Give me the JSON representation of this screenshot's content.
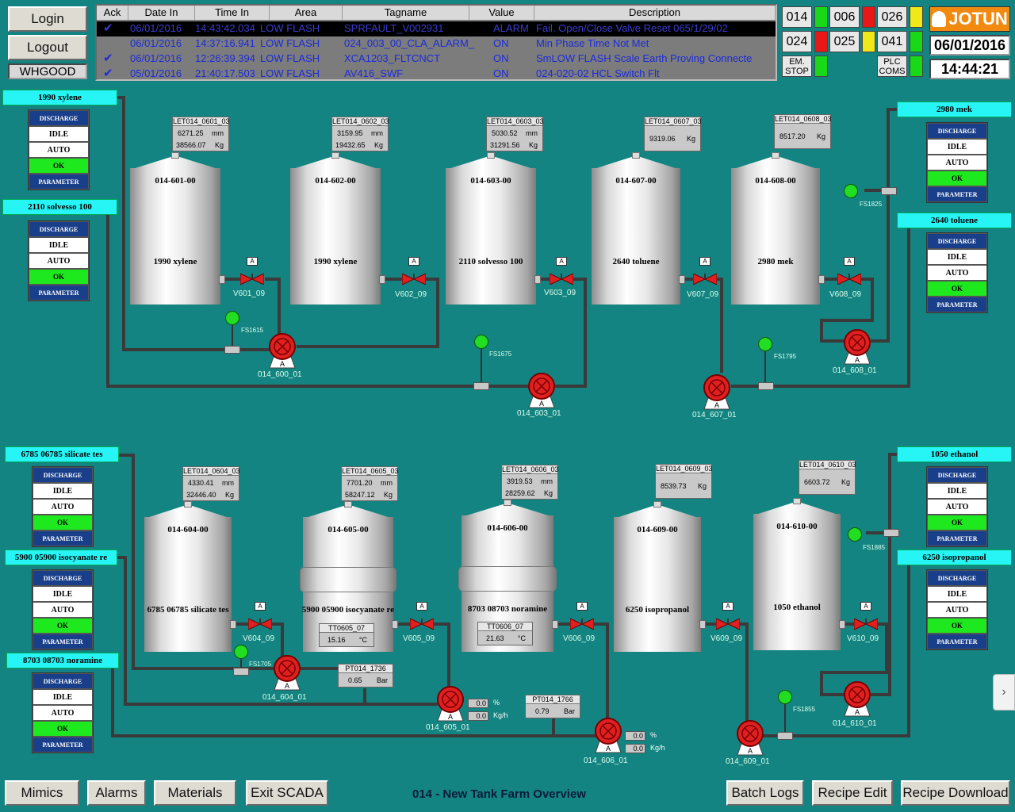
{
  "auth": {
    "login": "Login",
    "logout": "Logout",
    "user": "WHGOOD"
  },
  "alarms": {
    "headers": [
      "Ack",
      "Date In",
      "Time In",
      "Area",
      "Tagname",
      "Value",
      "Description"
    ],
    "rows": [
      {
        "ack": "✔",
        "date": "06/01/2016",
        "time": "14:43:42.034",
        "area": "LOW FLASH",
        "tag": "SPRFAULT_V002931",
        "value": "ALARM",
        "desc": "Fail. Open/Close Valve Reset 065/1/29/02"
      },
      {
        "ack": "",
        "date": "06/01/2016",
        "time": "14:37:16.941",
        "area": "LOW FLASH",
        "tag": "024_003_00_CLA_ALARM_",
        "value": "ON",
        "desc": "Min Phase Time Not Met"
      },
      {
        "ack": "✔",
        "date": "06/01/2016",
        "time": "12:26:39.394",
        "area": "LOW FLASH",
        "tag": "XCA1203_FLTCNCT",
        "value": "ON",
        "desc": "SmLOW FLASH Scale Earth Proving Connecte"
      },
      {
        "ack": "✔",
        "date": "05/01/2016",
        "time": "21:40:17.503",
        "area": "LOW FLASH",
        "tag": "AV416_SWF",
        "value": "ON",
        "desc": "024-020-02 HCL Switch Flt"
      }
    ]
  },
  "status": {
    "areas": [
      {
        "label": "014",
        "color": "#18d818"
      },
      {
        "label": "006",
        "color": "#e81818"
      },
      {
        "label": "026",
        "color": "#f0e818"
      },
      {
        "label": "024",
        "color": "#e81818"
      },
      {
        "label": "025",
        "color": "#f0e818"
      },
      {
        "label": "041",
        "color": "#18d818"
      }
    ],
    "em_stop": "EM. STOP",
    "plc_coms": "PLC COMS",
    "lamp_green": "#18d818"
  },
  "brand": {
    "logo": "JOTUN",
    "date": "06/01/2016",
    "time": "14:44:21"
  },
  "controls": {
    "discharge": "DISCHARGE",
    "idle": "IDLE",
    "auto": "AUTO",
    "ok": "OK",
    "parameter": "PARAMETER"
  },
  "side_labels": [
    "1990 xylene",
    "2110 solvesso 100",
    "2980 mek",
    "2640 toluene",
    "6785 06785 silicate tes",
    "5900 05900 isocyanate re",
    "8703 08703 noramine",
    "1050 ethanol",
    "6250 isopropanol"
  ],
  "tanks": [
    {
      "id": "014-601-00",
      "product": "1990 xylene",
      "disp": "LET014_0601_03",
      "v1": "6271.25",
      "u1": "mm",
      "v2": "38566.07",
      "u2": "Kg",
      "valve": "V601_09"
    },
    {
      "id": "014-602-00",
      "product": "1990 xylene",
      "disp": "LET014_0602_03",
      "v1": "3159.95",
      "u1": "mm",
      "v2": "19432.65",
      "u2": "Kg",
      "valve": "V602_09"
    },
    {
      "id": "014-603-00",
      "product": "2110 solvesso 100",
      "disp": "LET014_0603_03",
      "v1": "5030.52",
      "u1": "mm",
      "v2": "31291.56",
      "u2": "Kg",
      "valve": "V603_09"
    },
    {
      "id": "014-607-00",
      "product": "2640 toluene",
      "disp": "LET014_0607_03",
      "v1": "9319.06",
      "u1": "Kg",
      "valve": "V607_09"
    },
    {
      "id": "014-608-00",
      "product": "2980 mek",
      "disp": "LET014_0608_03",
      "v1": "8517.20",
      "u1": "Kg",
      "valve": "V608_09"
    },
    {
      "id": "014-604-00",
      "product": "6785 06785 silicate tes",
      "disp": "LET014_0604_03",
      "v1": "4330.41",
      "u1": "mm",
      "v2": "32446.40",
      "u2": "Kg",
      "valve": "V604_09"
    },
    {
      "id": "014-605-00",
      "product": "5900 05900 isocyanate re",
      "disp": "LET014_0605_03",
      "v1": "7701.20",
      "u1": "mm",
      "v2": "58247.12",
      "u2": "Kg",
      "valve": "V605_09",
      "temp_tag": "TT0605_07",
      "temp": "15.16",
      "temp_u": "°C"
    },
    {
      "id": "014-606-00",
      "product": "8703 08703 noramine",
      "disp": "LET014_0606_03",
      "v1": "3919.53",
      "u1": "mm",
      "v2": "28259.62",
      "u2": "Kg",
      "valve": "V606_09",
      "temp_tag": "TT0606_07",
      "temp": "21.63",
      "temp_u": "°C"
    },
    {
      "id": "014-609-00",
      "product": "6250 isopropanol",
      "disp": "LET014_0609_03",
      "v1": "8539.73",
      "u1": "Kg",
      "valve": "V609_09"
    },
    {
      "id": "014-610-00",
      "product": "1050 ethanol",
      "disp": "LET014_0610_03",
      "v1": "6603.72",
      "u1": "Kg",
      "valve": "V610_09"
    }
  ],
  "valve_mode": "A",
  "pumps": [
    "014_600_01",
    "014_603_01",
    "014_607_01",
    "014_608_01",
    "014_604_01",
    "014_605_01",
    "014_606_01",
    "014_609_01",
    "014_610_01"
  ],
  "switches": [
    "FS1615",
    "FS1675",
    "FS1795",
    "FS1825",
    "FS1705",
    "FS1855",
    "FS1885"
  ],
  "pressure": [
    {
      "tag": "PT014_1736",
      "value": "0.65",
      "unit": "Bar"
    },
    {
      "tag": "PT014_1766",
      "value": "0.79",
      "unit": "Bar"
    }
  ],
  "flows": {
    "pct": "0.0",
    "kgh": "0.0",
    "pct_u": "%",
    "kgh_u": "Kg/h"
  },
  "nav": {
    "mimics": "Mimics",
    "alarms": "Alarms",
    "materials": "Materials",
    "exit": "Exit SCADA",
    "title": "014 - New Tank Farm Overview",
    "batch": "Batch Logs",
    "recipe_edit": "Recipe Edit",
    "recipe_dl": "Recipe Download"
  },
  "colors": {
    "background": "#138481",
    "pipe": "#3a3a3a",
    "valve": "#e02020",
    "pump": "#e02020",
    "switch": "#22dd22",
    "label_cyan": "#27f5f5"
  }
}
